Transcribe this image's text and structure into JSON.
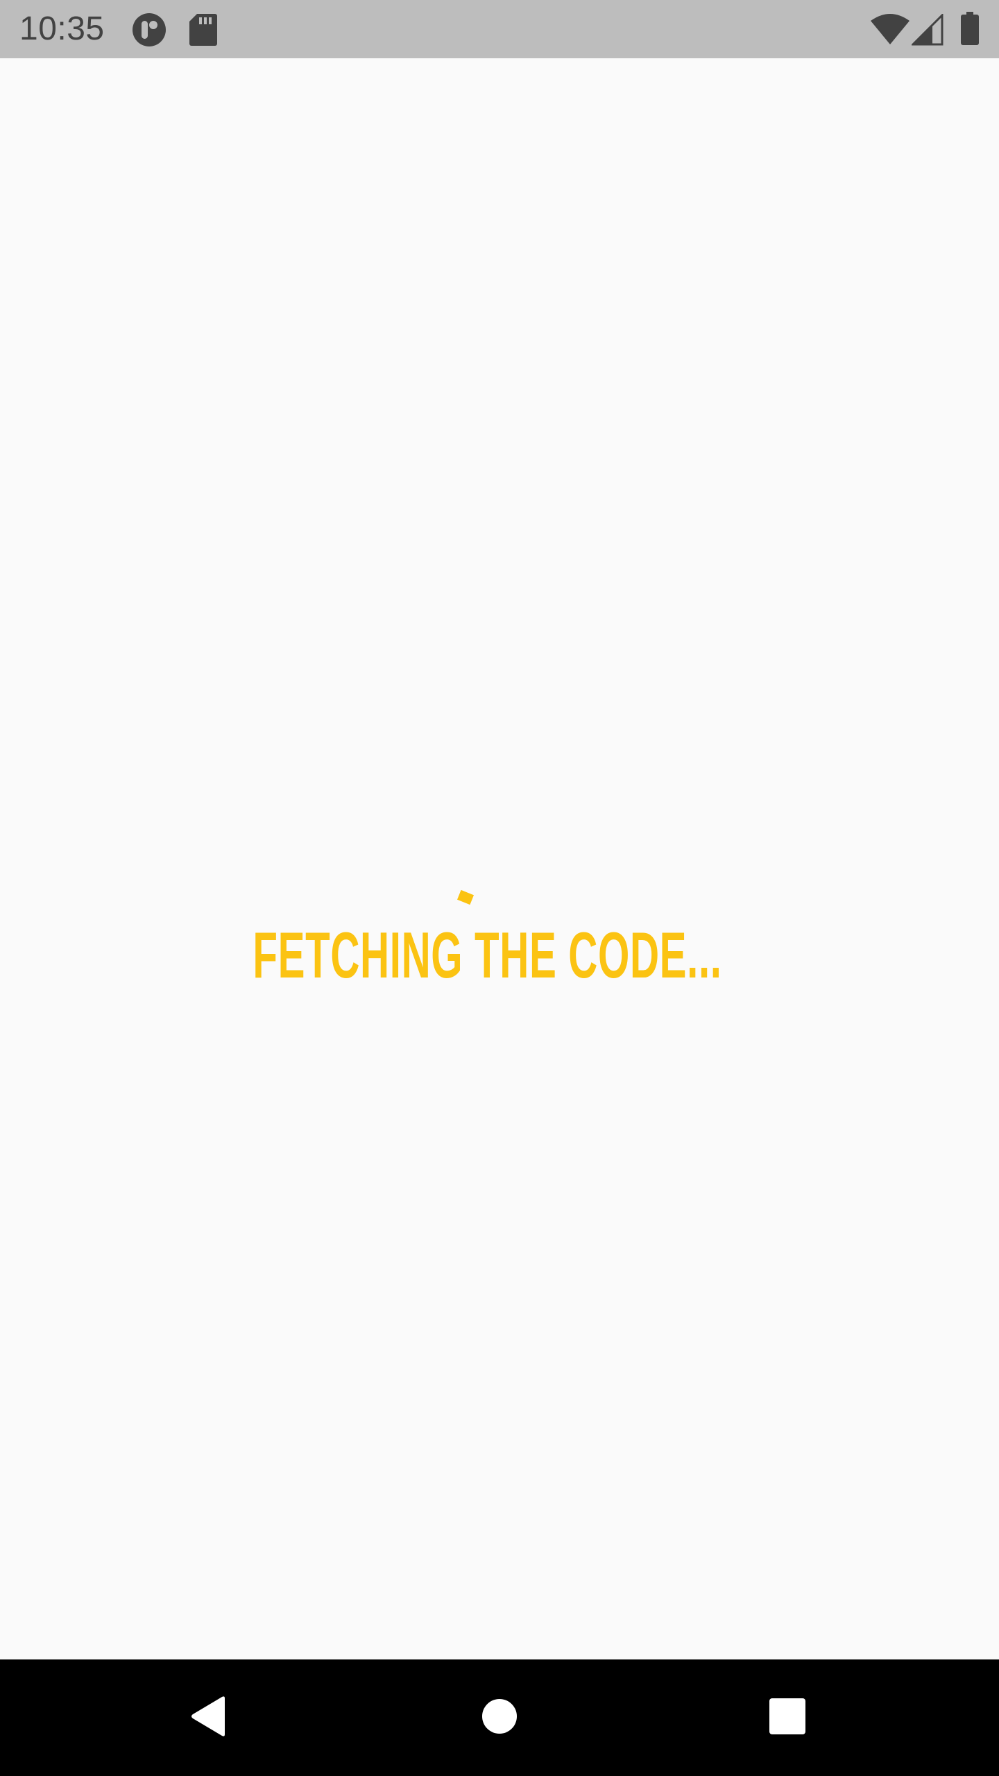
{
  "status_bar": {
    "time": "10:35",
    "left_icons": [
      "app-notification-icon",
      "sd-card-icon"
    ],
    "right_icons": [
      "wifi-icon",
      "cellular-signal-icon",
      "battery-icon"
    ]
  },
  "content": {
    "loading_text": "FETCHING THE CODE...",
    "spinner_icon": "loading-spinner-icon"
  },
  "nav_bar": {
    "buttons": [
      "back-icon",
      "home-icon",
      "recents-icon"
    ]
  },
  "colors": {
    "accent": "#fbc312",
    "status_bar_bg": "#bdbdbd",
    "status_icon": "#424242",
    "page_bg": "#fafafa",
    "nav_bg": "#000000",
    "nav_icon": "#ffffff"
  }
}
